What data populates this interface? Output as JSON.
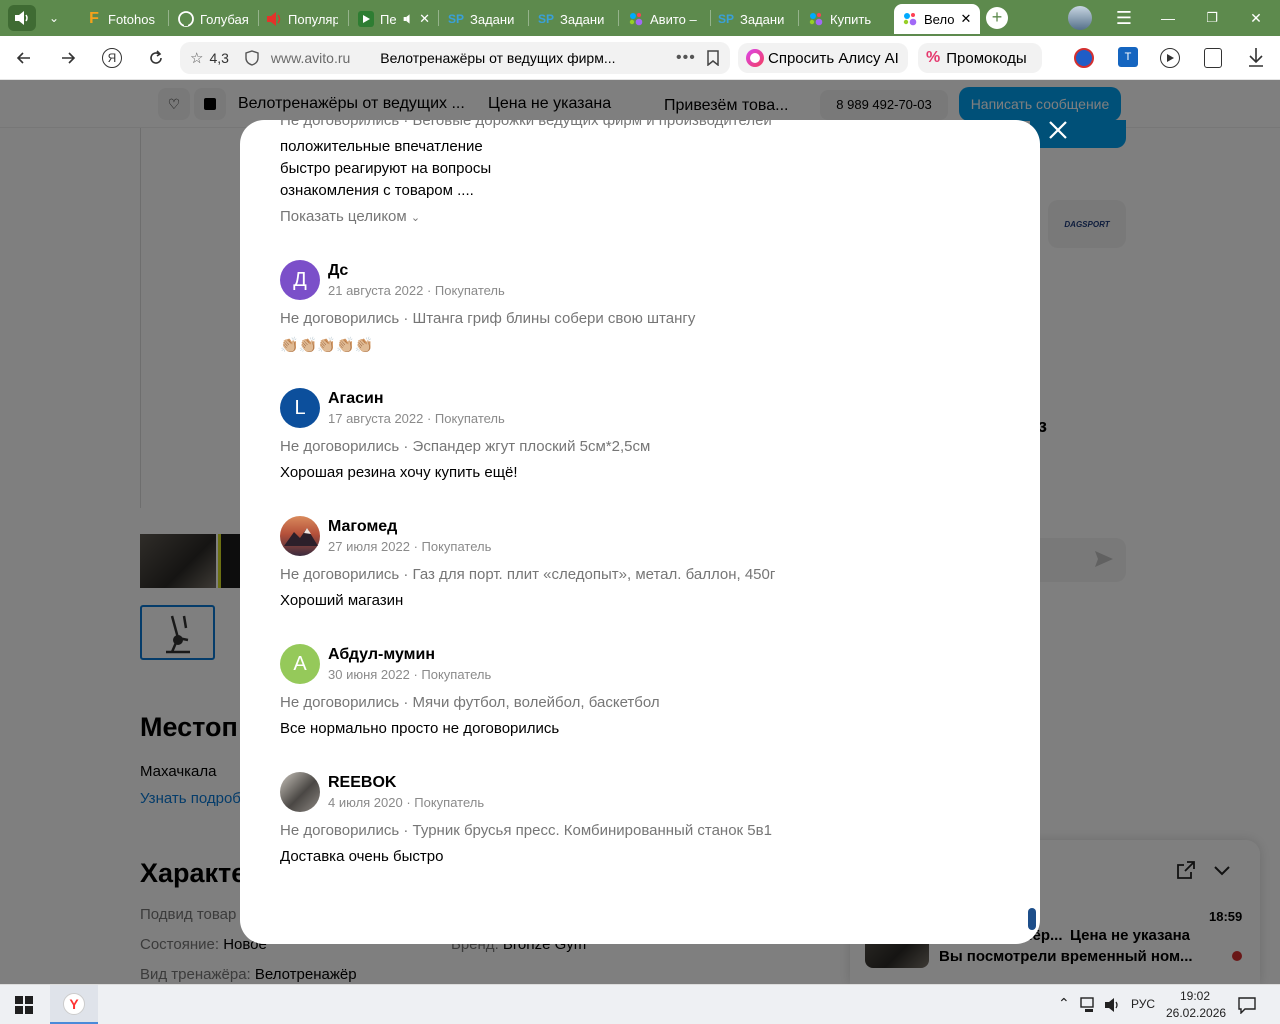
{
  "browser": {
    "tabs": [
      {
        "label": "Fotohos",
        "icon": "fotohost-icon"
      },
      {
        "label": "Голубая",
        "icon": "github-icon"
      },
      {
        "label": "Популяр",
        "icon": "audio-icon"
      },
      {
        "label": "Пе",
        "icon": "media-icon"
      },
      {
        "label": "Задани",
        "icon": "sp-icon"
      },
      {
        "label": "Задани",
        "icon": "sp-icon"
      },
      {
        "label": "Авито –",
        "icon": "avito-icon"
      },
      {
        "label": "Задани",
        "icon": "sp-icon"
      },
      {
        "label": "Купить",
        "icon": "avito-icon"
      },
      {
        "label": "Вело",
        "icon": "avito-icon"
      }
    ],
    "site_rating": "4,3",
    "url": "www.avito.ru",
    "page_title": "Велотренажёры от ведущих фирм...",
    "alice_button": "Спросить Алису AI",
    "promo_button": "Промокоды"
  },
  "page": {
    "sticky_title": "Велотренажёры от ведущих ...",
    "sticky_price": "Цена не указана",
    "sticky_delivery": "Привезём това...",
    "phone": "8 989 492-70-03",
    "message_button": "Написать сообщение",
    "location_heading": "Местоп",
    "city": "Махачкала",
    "location_link": "Узнать подроб",
    "characteristics_heading": "Характе",
    "char_row1": "Подвид товар",
    "condition_label": "Состояние:",
    "condition_value": "Новое",
    "brand_label": "Бренд:",
    "brand_value": "Bronze Gym",
    "type_label": "Вид тренажёра:",
    "type_value": "Велотренажёр",
    "seller_logo": "DAGSPORT",
    "partial_right": "з",
    "chat": {
      "time": "18:59",
      "title": "...ёр...",
      "price": "Цена не указана",
      "message": "Вы посмотрели временный ном..."
    }
  },
  "modal": {
    "top_partial": "Не договорились · Беговые дорожки ведущих фирм и производителей",
    "top_lines": [
      "положительные впечатление",
      "быстро реагируют на вопросы",
      "ознакомления с товаром ...."
    ],
    "show_full": "Показать целиком",
    "reviews": [
      {
        "name": "Дс",
        "initial": "Д",
        "avatar_color": "#7b4fc9",
        "date": "21 августа 2022 · Покупатель",
        "item": "Не договорились · Штанга гриф блины собери свою штангу",
        "text": "👏🏼👏🏼👏🏼👏🏼👏🏼"
      },
      {
        "name": "Агасин",
        "initial": "L",
        "avatar_color": "#0c4f9c",
        "date": "17 августа 2022 · Покупатель",
        "item": "Не договорились · Эспандер жгут плоский 5см*2,5см",
        "text": "Хорошая резина хочу купить ещё!"
      },
      {
        "name": "Магомед",
        "initial": "",
        "avatar_color": "#b5503a",
        "date": "27 июля 2022 · Покупатель",
        "item": "Не договорились · Газ для порт. плит «следопыт», метал. баллон, 450г",
        "text": "Хороший магазин"
      },
      {
        "name": "Абдул-мумин",
        "initial": "А",
        "avatar_color": "#95c95a",
        "date": "30 июня 2022 · Покупатель",
        "item": "Не договорились · Мячи футбол, волейбол, баскетбол",
        "text": "Все нормально просто не договорились"
      },
      {
        "name": "REEBOK",
        "initial": "",
        "avatar_color": "#6e6e6e",
        "date": "4 июля 2020 · Покупатель",
        "item": "Не договорились · Турник брусья пресс. Комбинированный станок 5в1",
        "text": "Доставка очень быстро"
      }
    ]
  },
  "taskbar": {
    "lang": "РУС",
    "time": "19:02",
    "date": "26.02.2026"
  }
}
